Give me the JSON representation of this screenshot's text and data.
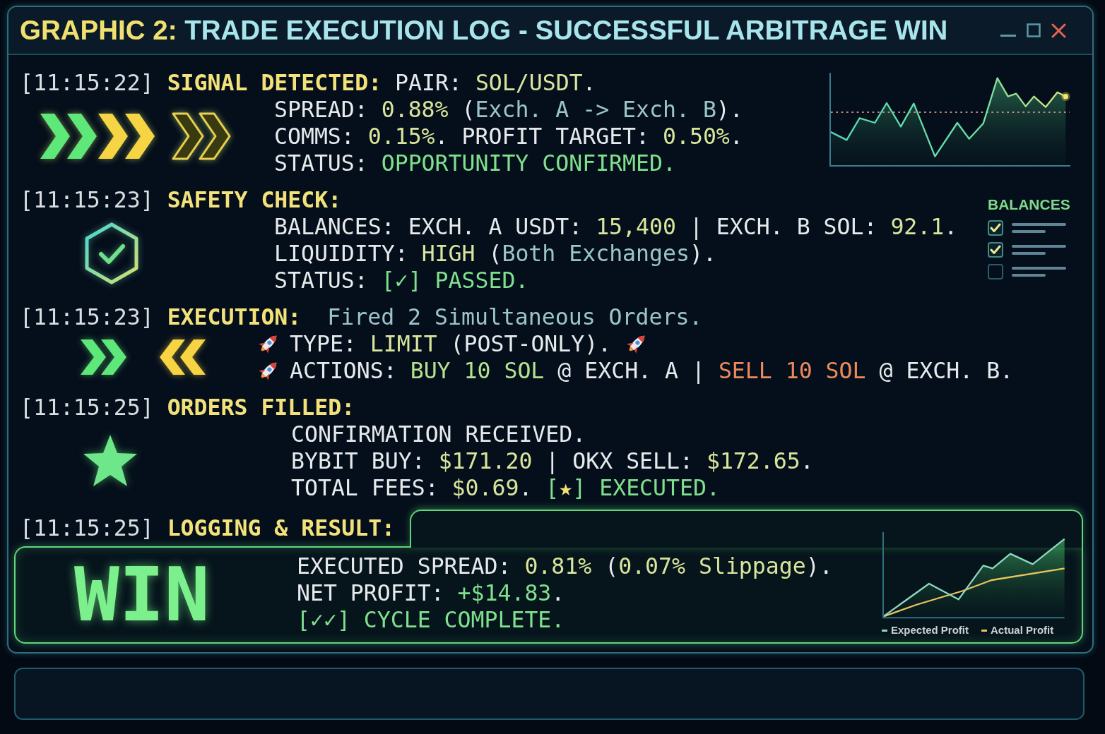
{
  "window": {
    "title_prefix": "GRAPHIC 2:",
    "title": "TRADE EXECUTION LOG - SUCCESSFUL ARBITRAGE WIN"
  },
  "log": [
    {
      "kind": "signal",
      "time": "[11:15:22]",
      "heading": "SIGNAL DETECTED:",
      "inline": [
        {
          "kind": "plain",
          "text": "PAIR: "
        },
        {
          "kind": "value",
          "text": "SOL/USDT"
        },
        {
          "kind": "plain",
          "text": "."
        }
      ],
      "lines": [
        [
          {
            "kind": "plain",
            "text": "SPREAD: "
          },
          {
            "kind": "value",
            "text": "0.88%"
          },
          {
            "kind": "plain",
            "text": " ("
          },
          {
            "kind": "note",
            "text": "Exch. A -> Exch. B"
          },
          {
            "kind": "plain",
            "text": ")."
          }
        ],
        [
          {
            "kind": "plain",
            "text": "COMMS: "
          },
          {
            "kind": "value",
            "text": "0.15%"
          },
          {
            "kind": "plain",
            "text": ". PROFIT TARGET: "
          },
          {
            "kind": "value",
            "text": "0.50%"
          },
          {
            "kind": "plain",
            "text": "."
          }
        ],
        [
          {
            "kind": "plain",
            "text": "STATUS: "
          },
          {
            "kind": "ok",
            "text": "OPPORTUNITY CONFIRMED."
          }
        ]
      ]
    },
    {
      "kind": "safety",
      "time": "[11:15:23]",
      "heading": "SAFETY CHECK:",
      "lines": [
        [
          {
            "kind": "plain",
            "text": "BALANCES: EXCH. A USDT: "
          },
          {
            "kind": "value",
            "text": "15,400"
          },
          {
            "kind": "plain",
            "text": " | EXCH. B SOL: "
          },
          {
            "kind": "value",
            "text": "92.1"
          },
          {
            "kind": "plain",
            "text": "."
          }
        ],
        [
          {
            "kind": "plain",
            "text": "LIQUIDITY: "
          },
          {
            "kind": "value",
            "text": "HIGH"
          },
          {
            "kind": "plain",
            "text": " ("
          },
          {
            "kind": "note",
            "text": "Both Exchanges"
          },
          {
            "kind": "plain",
            "text": ")."
          }
        ],
        [
          {
            "kind": "plain",
            "text": "STATUS: "
          },
          {
            "kind": "ok",
            "text": "[✓] PASSED."
          }
        ]
      ],
      "widget": {
        "title": "BALANCES",
        "items": [
          {
            "checked": true
          },
          {
            "checked": true
          },
          {
            "checked": false
          }
        ]
      }
    },
    {
      "kind": "execution",
      "time": "[11:15:23]",
      "heading": "EXECUTION:",
      "inline": [
        {
          "kind": "note",
          "text": "Fired 2 Simultaneous Orders."
        }
      ],
      "lines": [
        [
          {
            "kind": "plain",
            "text": "TYPE: "
          },
          {
            "kind": "value",
            "text": "LIMIT"
          },
          {
            "kind": "plain",
            "text": " (POST-ONLY)."
          }
        ],
        [
          {
            "kind": "plain",
            "text": "ACTIONS: "
          },
          {
            "kind": "buy",
            "text": "BUY 10 SOL"
          },
          {
            "kind": "plain",
            "text": " @ EXCH. A | "
          },
          {
            "kind": "sell",
            "text": "SELL 10 SOL"
          },
          {
            "kind": "plain",
            "text": " @ EXCH. B."
          }
        ]
      ]
    },
    {
      "kind": "fill",
      "time": "[11:15:25]",
      "heading": "ORDERS FILLED:",
      "lines": [
        [
          {
            "kind": "plain",
            "text": "CONFIRMATION RECEIVED."
          }
        ],
        [
          {
            "kind": "plain",
            "text": "BYBIT BUY: "
          },
          {
            "kind": "value",
            "text": "$171.20"
          },
          {
            "kind": "plain",
            "text": " | OKX SELL: "
          },
          {
            "kind": "value",
            "text": "$172.65"
          },
          {
            "kind": "plain",
            "text": "."
          }
        ],
        [
          {
            "kind": "plain",
            "text": "TOTAL FEES: "
          },
          {
            "kind": "value",
            "text": "$0.69"
          },
          {
            "kind": "plain",
            "text": ". "
          },
          {
            "kind": "ok",
            "text": "["
          },
          {
            "kind": "head",
            "text": "★"
          },
          {
            "kind": "ok",
            "text": "] EXECUTED."
          }
        ]
      ]
    }
  ],
  "result": {
    "time": "[11:15:25]",
    "heading": "LOGGING & RESULT:",
    "outcome": "WIN",
    "lines": [
      [
        {
          "kind": "plain",
          "text": "EXECUTED SPREAD: "
        },
        {
          "kind": "value",
          "text": "0.81%"
        },
        {
          "kind": "plain",
          "text": " ("
        },
        {
          "kind": "value",
          "text": "0.07% Slippage"
        },
        {
          "kind": "plain",
          "text": ")."
        }
      ],
      [
        {
          "kind": "plain",
          "text": "NET PROFIT: "
        },
        {
          "kind": "ok",
          "text": "+$14.83"
        },
        {
          "kind": "plain",
          "text": "."
        }
      ],
      [
        {
          "kind": "ok",
          "text": "[✓✓] CYCLE COMPLETE."
        }
      ]
    ],
    "legend": [
      {
        "label": "Expected Profit",
        "color": "#8fd6c0"
      },
      {
        "label": "Actual Profit",
        "color": "#e6c65c"
      }
    ]
  }
}
